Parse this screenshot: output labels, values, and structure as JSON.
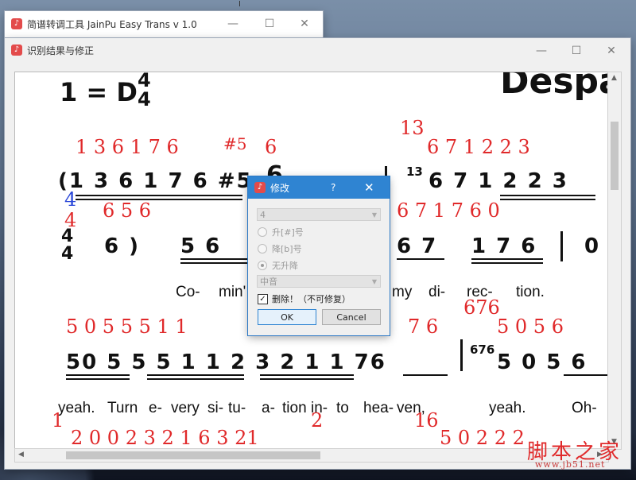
{
  "main_window": {
    "title": "简谱转调工具 JainPu Easy Trans v 1.0",
    "ctl_min": "—",
    "ctl_max": "☐",
    "ctl_close": "✕"
  },
  "result_window": {
    "title": "识别结果与修正",
    "ctl_min": "—",
    "ctl_max": "☐",
    "ctl_close": "✕"
  },
  "score": {
    "key_text": "1 = D",
    "time_num": "4",
    "time_den": "4",
    "banner": "Despa",
    "row1_red_top": "1  3 6 1 7 6",
    "row1_red_sharp": "#5",
    "row1_red_6": "6",
    "row1_red_13": "13",
    "row1_red_right": "6    7     1   2  2  3",
    "row1_notes_left": "(1 3 6 1 7 6 #5",
    "row1_notes_right": "6   7    1 2 2 3",
    "row1_sub13": "13",
    "row1_red_below": "6          5      6",
    "row1_red_below_right": "6    7    1    7  6        0",
    "blue_4": "4",
    "red_4": "4",
    "time2_num": "4",
    "time2_den": "4",
    "row2_notes_a": "6 )",
    "row2_notes_b": "5     6",
    "row2_notes_c": "6   7",
    "row2_notes_d": "1 7 6",
    "row2_notes_e": "0",
    "lyrics1": [
      "Co-",
      "min'",
      "my",
      "di-",
      "rec-",
      "tion."
    ],
    "red_676": "676",
    "row3_red": "5 0   5   5   5 1 1",
    "row3_red_right": "7 6",
    "row3_red_far": "5    0   5 6",
    "row3_notes": "50  5   5  5 1 1   2 3 2 1   1   76",
    "row3_notes_right": "5    0 5 6",
    "row3_box676": "676",
    "lyrics2": [
      "yeah.",
      "Turn",
      "e-",
      "very",
      "si-",
      "tu-",
      "a-",
      "tion",
      "in-",
      "to",
      "hea-",
      "ven,",
      "yeah.",
      "Oh-"
    ],
    "red_1": "1",
    "red_2": "2",
    "red_16": "16",
    "row4_red": "2   0  0 2  3  2  1   6   3  21",
    "row4_red_right": "5   0   2    2   2"
  },
  "dialog": {
    "title": "修改",
    "help": "?",
    "close": "✕",
    "select_value": "4",
    "radio_sharp": "升[#]号",
    "radio_flat": "降[b]号",
    "radio_none": "无升降",
    "octave_value": "中音",
    "delete_label": "删除！（不可修复）",
    "ok": "OK",
    "cancel": "Cancel"
  },
  "watermark": {
    "text": "脚本之家",
    "url": "www.jb51.net"
  }
}
